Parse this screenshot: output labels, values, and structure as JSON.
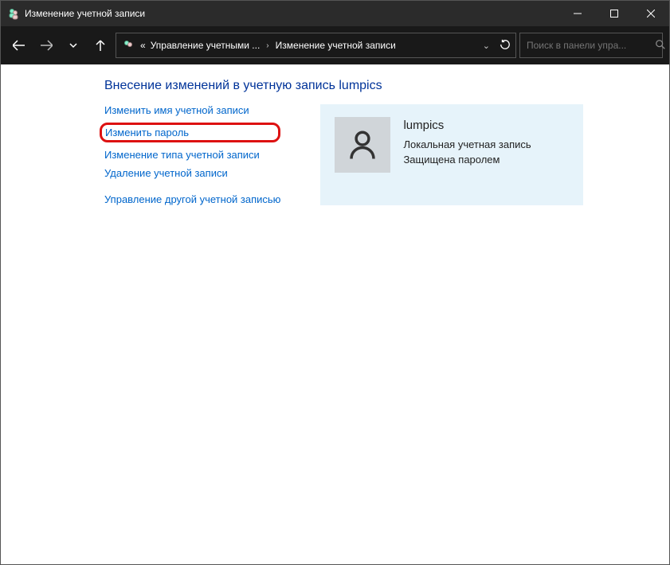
{
  "titlebar": {
    "title": "Изменение учетной записи"
  },
  "breadcrumb": {
    "prefix": "«",
    "item1": "Управление учетными ...",
    "item2": "Изменение учетной записи"
  },
  "search": {
    "placeholder": "Поиск в панели упра..."
  },
  "heading": "Внесение изменений в учетную запись lumpics",
  "links": {
    "rename": "Изменить имя учетной записи",
    "password": "Изменить пароль",
    "type": "Изменение типа учетной записи",
    "delete": "Удаление учетной записи",
    "other": "Управление другой учетной записью"
  },
  "account": {
    "name": "lumpics",
    "type": "Локальная учетная запись",
    "status": "Защищена паролем"
  }
}
